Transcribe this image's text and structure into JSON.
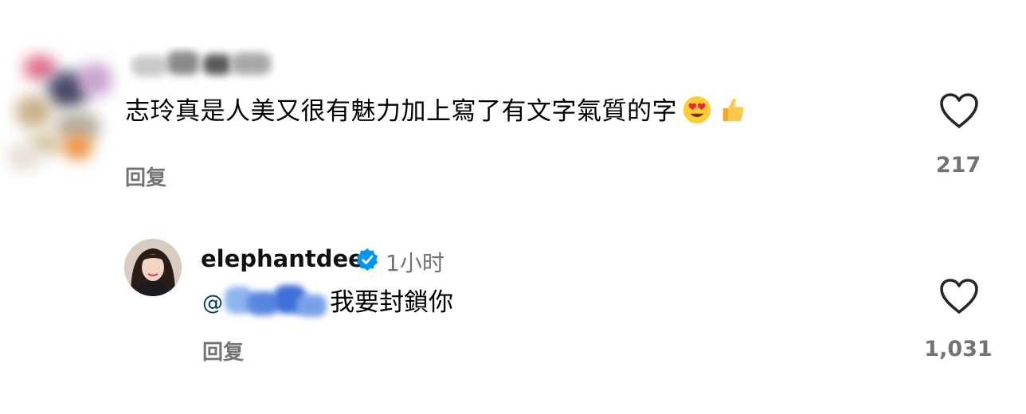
{
  "comments": [
    {
      "username": "",
      "text": "志玲真是人美又很有魅力加上寫了有文字氣質的字",
      "emojis": [
        "heart-eyes-emoji",
        "thumbs-up-emoji"
      ],
      "reply_label": "回复",
      "like_count": "217",
      "like_icon": "heart-outline-icon",
      "avatar_blurred": true,
      "username_blurred": true
    },
    {
      "username": "elephantdee",
      "verified": true,
      "verified_color": "#0095f6",
      "time": "1小时",
      "mention_prefix": "@",
      "mention_blurred": true,
      "text": "我要封鎖你",
      "reply_label": "回复",
      "like_count": "1,031",
      "like_icon": "heart-outline-icon"
    }
  ],
  "colors": {
    "secondary_text": "#737373",
    "mention": "#00376b",
    "verified_badge": "#0095f6"
  }
}
